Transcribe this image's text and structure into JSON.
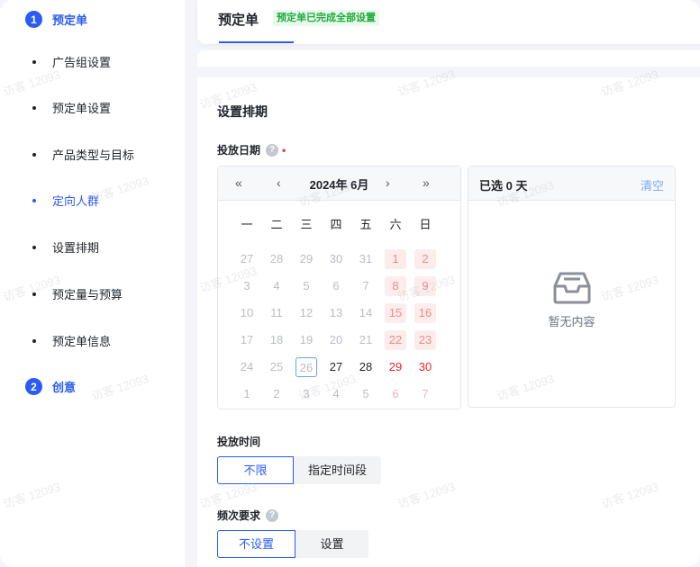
{
  "sidebar": {
    "steps": [
      {
        "num": "1",
        "label": "预定单"
      },
      {
        "num": "2",
        "label": "创意"
      }
    ],
    "items": [
      {
        "label": "广告组设置",
        "active": false
      },
      {
        "label": "预定单设置",
        "active": false
      },
      {
        "label": "产品类型与目标",
        "active": false
      },
      {
        "label": "定向人群",
        "active": true
      },
      {
        "label": "设置排期",
        "active": false
      },
      {
        "label": "预定量与预算",
        "active": false
      },
      {
        "label": "预定单信息",
        "active": false
      }
    ]
  },
  "header": {
    "title": "预定单",
    "badge": "预定单已完成全部设置"
  },
  "main": {
    "section_title": "设置排期",
    "date_label": "投放日期",
    "help_glyph": "?",
    "required_mark": "•",
    "calendar": {
      "nav_prev_year": "«",
      "nav_prev_month": "‹",
      "title": "2024年 6月",
      "nav_next_month": "›",
      "nav_next_year": "»",
      "weekdays": [
        "一",
        "二",
        "三",
        "四",
        "五",
        "六",
        "日"
      ],
      "weeks": [
        [
          "27",
          "28",
          "29",
          "30",
          "31",
          "1",
          "2"
        ],
        [
          "3",
          "4",
          "5",
          "6",
          "7",
          "8",
          "9"
        ],
        [
          "10",
          "11",
          "12",
          "13",
          "14",
          "15",
          "16"
        ],
        [
          "17",
          "18",
          "19",
          "20",
          "21",
          "22",
          "23"
        ],
        [
          "24",
          "25",
          "26",
          "27",
          "28",
          "29",
          "30"
        ],
        [
          "1",
          "2",
          "3",
          "4",
          "5",
          "6",
          "7"
        ]
      ],
      "today": "26"
    },
    "selected": {
      "count_label": "已选 0 天",
      "clear_label": "清空",
      "empty_text": "暂无内容"
    },
    "time": {
      "label": "投放时间",
      "options": [
        "不限",
        "指定时间段"
      ],
      "selected": "不限"
    },
    "frequency": {
      "label": "频次要求",
      "options": [
        "不设置",
        "设置"
      ],
      "selected": "不设置"
    }
  },
  "watermark": "访客 12093",
  "colors": {
    "accent": "#2b5bf4",
    "success_bg": "#e9f9ec",
    "success_text": "#1eab3d",
    "weekend": "#e5262c",
    "clear_link": "#7aa8f7"
  }
}
